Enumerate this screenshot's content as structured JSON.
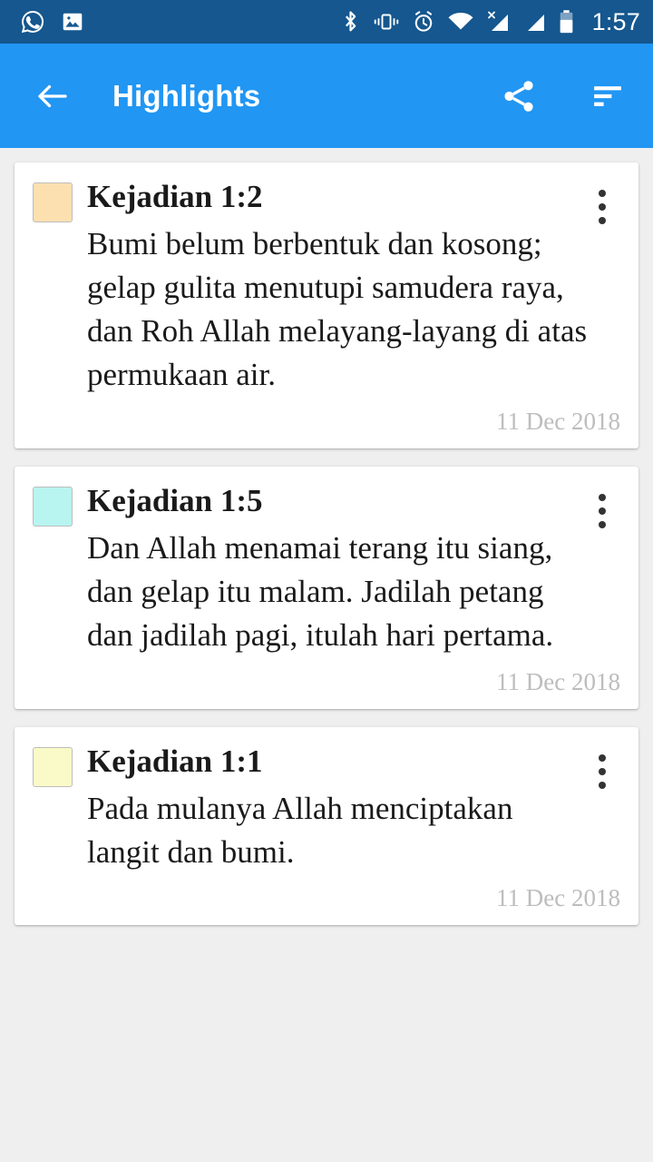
{
  "status_bar": {
    "background": "#15578E",
    "time": "1:57",
    "left_icons": [
      "whatsapp-icon",
      "photo-icon"
    ],
    "right_icons": [
      "bluetooth-icon",
      "vibrate-icon",
      "alarm-icon",
      "wifi-icon",
      "signal-no-service-icon",
      "signal-icon",
      "battery-icon"
    ]
  },
  "app_bar": {
    "background": "#2196F3",
    "title": "Highlights",
    "back_label": "Back",
    "share_label": "Share",
    "sort_label": "Sort"
  },
  "page": {
    "background": "#EFEFEF"
  },
  "highlights": [
    {
      "color": "#FCE0B0",
      "reference": "Kejadian 1:2",
      "text": "Bumi belum berbentuk dan kosong; gelap gulita menutupi samudera raya, dan Roh Allah melayang-layang di atas permukaan air.",
      "date": "11 Dec 2018",
      "menu_label": "More options"
    },
    {
      "color": "#B8F4F0",
      "reference": "Kejadian 1:5",
      "text": "Dan Allah menamai terang itu siang, dan gelap itu malam. Jadilah petang dan jadilah pagi, itulah hari pertama.",
      "date": "11 Dec 2018",
      "menu_label": "More options"
    },
    {
      "color": "#FAFAC8",
      "reference": "Kejadian 1:1",
      "text": "Pada mulanya Allah menciptakan langit dan bumi.",
      "date": "11 Dec 2018",
      "menu_label": "More options"
    }
  ]
}
